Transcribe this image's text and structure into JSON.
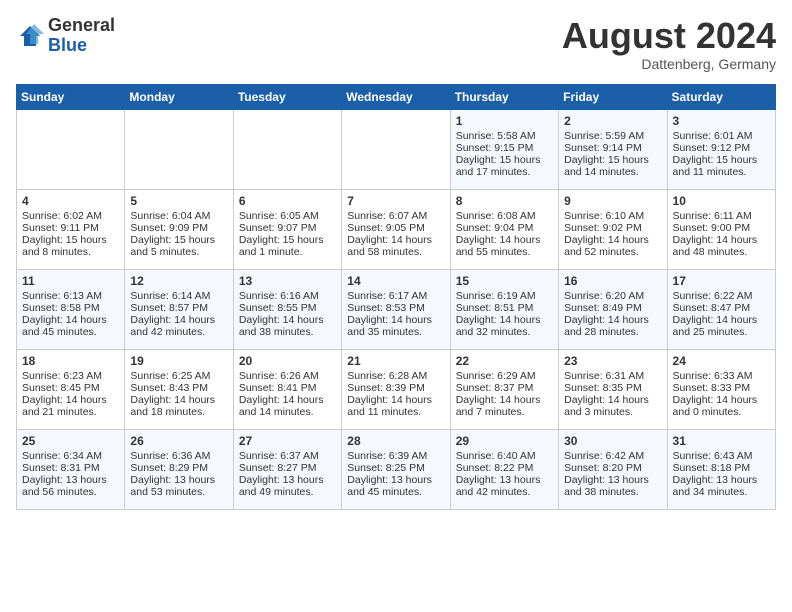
{
  "header": {
    "logo_general": "General",
    "logo_blue": "Blue",
    "month_title": "August 2024",
    "location": "Dattenberg, Germany"
  },
  "days_of_week": [
    "Sunday",
    "Monday",
    "Tuesday",
    "Wednesday",
    "Thursday",
    "Friday",
    "Saturday"
  ],
  "weeks": [
    [
      {
        "day": "",
        "content": ""
      },
      {
        "day": "",
        "content": ""
      },
      {
        "day": "",
        "content": ""
      },
      {
        "day": "",
        "content": ""
      },
      {
        "day": "1",
        "content": "Sunrise: 5:58 AM\nSunset: 9:15 PM\nDaylight: 15 hours and 17 minutes."
      },
      {
        "day": "2",
        "content": "Sunrise: 5:59 AM\nSunset: 9:14 PM\nDaylight: 15 hours and 14 minutes."
      },
      {
        "day": "3",
        "content": "Sunrise: 6:01 AM\nSunset: 9:12 PM\nDaylight: 15 hours and 11 minutes."
      }
    ],
    [
      {
        "day": "4",
        "content": "Sunrise: 6:02 AM\nSunset: 9:11 PM\nDaylight: 15 hours and 8 minutes."
      },
      {
        "day": "5",
        "content": "Sunrise: 6:04 AM\nSunset: 9:09 PM\nDaylight: 15 hours and 5 minutes."
      },
      {
        "day": "6",
        "content": "Sunrise: 6:05 AM\nSunset: 9:07 PM\nDaylight: 15 hours and 1 minute."
      },
      {
        "day": "7",
        "content": "Sunrise: 6:07 AM\nSunset: 9:05 PM\nDaylight: 14 hours and 58 minutes."
      },
      {
        "day": "8",
        "content": "Sunrise: 6:08 AM\nSunset: 9:04 PM\nDaylight: 14 hours and 55 minutes."
      },
      {
        "day": "9",
        "content": "Sunrise: 6:10 AM\nSunset: 9:02 PM\nDaylight: 14 hours and 52 minutes."
      },
      {
        "day": "10",
        "content": "Sunrise: 6:11 AM\nSunset: 9:00 PM\nDaylight: 14 hours and 48 minutes."
      }
    ],
    [
      {
        "day": "11",
        "content": "Sunrise: 6:13 AM\nSunset: 8:58 PM\nDaylight: 14 hours and 45 minutes."
      },
      {
        "day": "12",
        "content": "Sunrise: 6:14 AM\nSunset: 8:57 PM\nDaylight: 14 hours and 42 minutes."
      },
      {
        "day": "13",
        "content": "Sunrise: 6:16 AM\nSunset: 8:55 PM\nDaylight: 14 hours and 38 minutes."
      },
      {
        "day": "14",
        "content": "Sunrise: 6:17 AM\nSunset: 8:53 PM\nDaylight: 14 hours and 35 minutes."
      },
      {
        "day": "15",
        "content": "Sunrise: 6:19 AM\nSunset: 8:51 PM\nDaylight: 14 hours and 32 minutes."
      },
      {
        "day": "16",
        "content": "Sunrise: 6:20 AM\nSunset: 8:49 PM\nDaylight: 14 hours and 28 minutes."
      },
      {
        "day": "17",
        "content": "Sunrise: 6:22 AM\nSunset: 8:47 PM\nDaylight: 14 hours and 25 minutes."
      }
    ],
    [
      {
        "day": "18",
        "content": "Sunrise: 6:23 AM\nSunset: 8:45 PM\nDaylight: 14 hours and 21 minutes."
      },
      {
        "day": "19",
        "content": "Sunrise: 6:25 AM\nSunset: 8:43 PM\nDaylight: 14 hours and 18 minutes."
      },
      {
        "day": "20",
        "content": "Sunrise: 6:26 AM\nSunset: 8:41 PM\nDaylight: 14 hours and 14 minutes."
      },
      {
        "day": "21",
        "content": "Sunrise: 6:28 AM\nSunset: 8:39 PM\nDaylight: 14 hours and 11 minutes."
      },
      {
        "day": "22",
        "content": "Sunrise: 6:29 AM\nSunset: 8:37 PM\nDaylight: 14 hours and 7 minutes."
      },
      {
        "day": "23",
        "content": "Sunrise: 6:31 AM\nSunset: 8:35 PM\nDaylight: 14 hours and 3 minutes."
      },
      {
        "day": "24",
        "content": "Sunrise: 6:33 AM\nSunset: 8:33 PM\nDaylight: 14 hours and 0 minutes."
      }
    ],
    [
      {
        "day": "25",
        "content": "Sunrise: 6:34 AM\nSunset: 8:31 PM\nDaylight: 13 hours and 56 minutes."
      },
      {
        "day": "26",
        "content": "Sunrise: 6:36 AM\nSunset: 8:29 PM\nDaylight: 13 hours and 53 minutes."
      },
      {
        "day": "27",
        "content": "Sunrise: 6:37 AM\nSunset: 8:27 PM\nDaylight: 13 hours and 49 minutes."
      },
      {
        "day": "28",
        "content": "Sunrise: 6:39 AM\nSunset: 8:25 PM\nDaylight: 13 hours and 45 minutes."
      },
      {
        "day": "29",
        "content": "Sunrise: 6:40 AM\nSunset: 8:22 PM\nDaylight: 13 hours and 42 minutes."
      },
      {
        "day": "30",
        "content": "Sunrise: 6:42 AM\nSunset: 8:20 PM\nDaylight: 13 hours and 38 minutes."
      },
      {
        "day": "31",
        "content": "Sunrise: 6:43 AM\nSunset: 8:18 PM\nDaylight: 13 hours and 34 minutes."
      }
    ]
  ]
}
